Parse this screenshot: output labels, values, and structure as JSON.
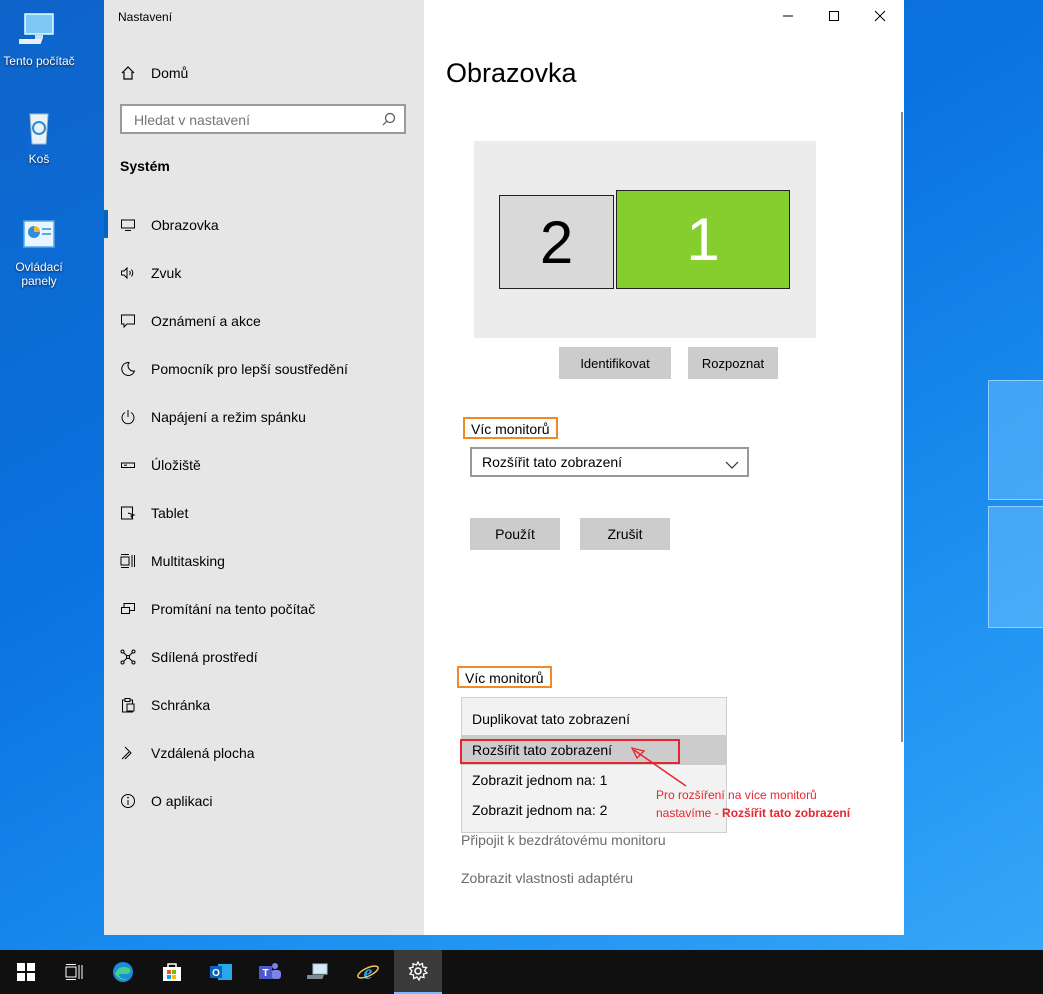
{
  "desktop": {
    "icons": [
      {
        "label": "Tento počítač"
      },
      {
        "label": "Koš"
      },
      {
        "label": "Ovládací panely"
      }
    ]
  },
  "window": {
    "title": "Nastavení",
    "controls": {
      "minimize": "—",
      "maximize": "☐",
      "close": "✕"
    }
  },
  "sidebar": {
    "home": "Domů",
    "search_placeholder": "Hledat v nastavení",
    "section": "Systém",
    "items": [
      {
        "label": "Obrazovka",
        "icon": "monitor-icon"
      },
      {
        "label": "Zvuk",
        "icon": "speaker-icon"
      },
      {
        "label": "Oznámení a akce",
        "icon": "notification-icon"
      },
      {
        "label": "Pomocník pro lepší soustředění",
        "icon": "moon-icon"
      },
      {
        "label": "Napájení a režim spánku",
        "icon": "power-icon"
      },
      {
        "label": "Úložiště",
        "icon": "storage-icon"
      },
      {
        "label": "Tablet",
        "icon": "tablet-icon"
      },
      {
        "label": "Multitasking",
        "icon": "multitasking-icon"
      },
      {
        "label": "Promítání na tento počítač",
        "icon": "projecting-icon"
      },
      {
        "label": "Sdílená prostředí",
        "icon": "shared-icon"
      },
      {
        "label": "Schránka",
        "icon": "clipboard-icon"
      },
      {
        "label": "Vzdálená plocha",
        "icon": "remote-desktop-icon"
      },
      {
        "label": "O aplikaci",
        "icon": "info-icon"
      }
    ]
  },
  "main": {
    "title": "Obrazovka",
    "monitors": [
      {
        "number": "2",
        "color": "#d9d9d9"
      },
      {
        "number": "1",
        "color": "#86ce2e"
      }
    ],
    "identify_button": "Identifikovat",
    "detect_button": "Rozpoznat",
    "multiple_displays_label": "Víc monitorů",
    "multiple_displays_value": "Rozšířit tato zobrazení",
    "apply_button": "Použít",
    "cancel_button": "Zrušit",
    "multiple_displays_label2": "Víc monitorů",
    "dropdown_options": [
      "Duplikovat tato zobrazení",
      "Rozšířit tato zobrazení",
      "Zobrazit jednom na: 1",
      "Zobrazit jednom na: 2"
    ],
    "dropdown_selected": "Rozšířit tato zobrazení",
    "wireless_link": "Připojit k bezdrátovému monitoru",
    "adapter_link": "Zobrazit vlastnosti adaptéru",
    "annotation_line1": "Pro rozšíření na více monitorů",
    "annotation_line2_prefix": "nastavíme - ",
    "annotation_line2_bold": "Rozšířit tato zobrazení"
  },
  "colors": {
    "accent": "#0067c0",
    "highlight_orange": "#f08a24",
    "annotation_red": "#e8242d",
    "monitor1_green": "#86ce2e"
  },
  "taskbar": {
    "items": [
      "start-icon",
      "task-view-icon",
      "edge-icon",
      "store-icon",
      "outlook-icon",
      "teams-icon",
      "network-icon",
      "ie-icon",
      "settings-icon"
    ]
  }
}
